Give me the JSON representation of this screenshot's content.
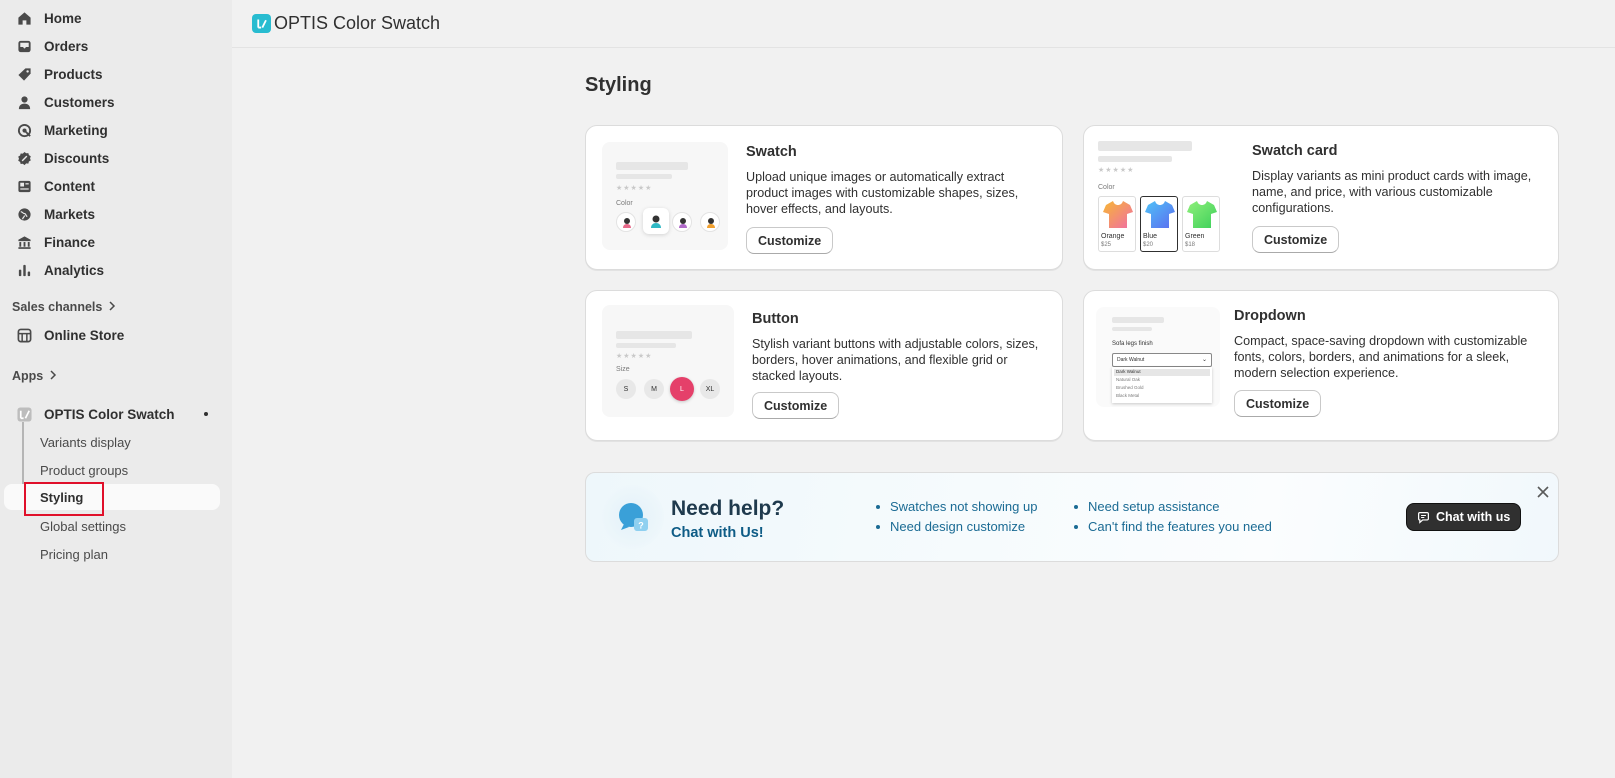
{
  "sidebar": {
    "items": [
      {
        "label": "Home",
        "icon": "home-icon"
      },
      {
        "label": "Orders",
        "icon": "inbox-icon"
      },
      {
        "label": "Products",
        "icon": "tag-icon"
      },
      {
        "label": "Customers",
        "icon": "person-icon"
      },
      {
        "label": "Marketing",
        "icon": "target-icon"
      },
      {
        "label": "Discounts",
        "icon": "discount-icon"
      },
      {
        "label": "Content",
        "icon": "content-icon"
      },
      {
        "label": "Markets",
        "icon": "globe-icon"
      },
      {
        "label": "Finance",
        "icon": "bank-icon"
      },
      {
        "label": "Analytics",
        "icon": "bar-chart-icon"
      }
    ],
    "sales_channels": {
      "label": "Sales channels",
      "items": [
        {
          "label": "Online Store",
          "icon": "store-icon"
        }
      ]
    },
    "apps": {
      "label": "Apps"
    },
    "app": {
      "label": "OPTIS Color Swatch",
      "sub_items": [
        "Variants display",
        "Product groups",
        "Styling",
        "Global settings",
        "Pricing plan"
      ]
    }
  },
  "header": {
    "title": "OPTIS Color Swatch"
  },
  "page": {
    "title": "Styling"
  },
  "cards": {
    "swatch": {
      "title": "Swatch",
      "desc": "Upload unique images or automatically extract product images with customizable shapes, sizes, hover effects, and layouts.",
      "button": "Customize",
      "preview": {
        "label": "Color"
      }
    },
    "swatch_card": {
      "title": "Swatch card",
      "desc": "Display variants as mini product cards with image, name, and price, with various customizable configurations.",
      "button": "Customize",
      "preview": {
        "label": "Color",
        "options": [
          {
            "name": "Orange",
            "price": "$25"
          },
          {
            "name": "Blue",
            "price": "$20"
          },
          {
            "name": "Green",
            "price": "$18"
          }
        ]
      }
    },
    "button": {
      "title": "Button",
      "desc": "Stylish variant buttons with adjustable colors, sizes, borders, hover animations, and flexible grid or stacked layouts.",
      "button": "Customize",
      "preview": {
        "label": "Size",
        "sizes": [
          "S",
          "M",
          "L",
          "XL"
        ]
      }
    },
    "dropdown": {
      "title": "Dropdown",
      "desc": "Compact, space-saving dropdown with customizable fonts, colors, borders, and animations for a sleek, modern selection experience.",
      "button": "Customize",
      "preview": {
        "label": "Sofa legs finish",
        "selected": "Dark Walnut",
        "options": [
          "Dark Walnut",
          "Natural Oak",
          "Brushed Gold",
          "Black Metal"
        ]
      }
    }
  },
  "help": {
    "title": "Need help?",
    "subtitle": "Chat with Us!",
    "list1": [
      "Swatches not showing up",
      "Need design customize"
    ],
    "list2": [
      "Need setup assistance",
      "Can't find the features you need"
    ],
    "chat_button": "Chat with us"
  },
  "colors": {
    "accent": "#28bcd0",
    "highlight": "#e0102a",
    "help_text": "#1b6b94"
  }
}
